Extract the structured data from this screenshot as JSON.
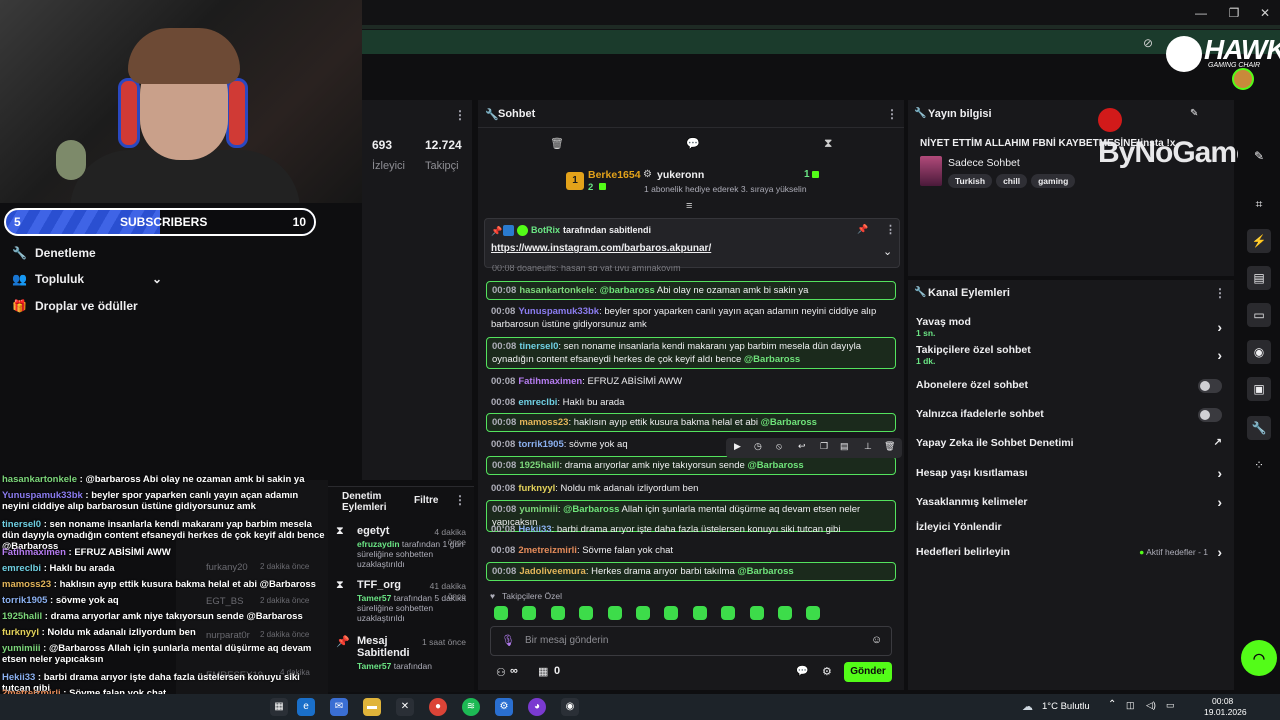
{
  "overlay": {
    "sub_left": "5",
    "sub_label": "SUBSCRIBERS",
    "sub_right": "10",
    "progress_fraction": 0.5,
    "hawk_brand": "HAWK",
    "hawk_sub": "GAMING CHAIR",
    "bynogame": "ByNoGame"
  },
  "left_nav": [
    {
      "label": "Denetleme",
      "icon": "wrench-icon"
    },
    {
      "label": "Topluluk",
      "icon": "community-icon"
    },
    {
      "label": "Droplar ve ödüller",
      "icon": "gift-icon"
    }
  ],
  "stats": {
    "viewers_value": "693",
    "viewers_label": "İzleyici",
    "followers_value": "12.724",
    "followers_label": "Takipçi"
  },
  "overlay_chat": [
    {
      "user": "hasankartonkele",
      "color": "#7cd67a",
      "text": "@barbaross Abi olay ne ozaman amk bi sakin ya"
    },
    {
      "user": "Yunuspamuk33bk",
      "color": "#8b7cf0",
      "text": "beyler spor yaparken canlı yayın açan adamın neyini ciddiye alıp barbarosun üstüne gidiyorsunuz amk"
    },
    {
      "user": "tinersel0",
      "color": "#6fd0e3",
      "text": "sen noname insanlarla kendi makaranı yap barbim mesela dün dayıyla oynadığın content efsaneydi herkes de çok keyif aldı bence @Barbaross"
    },
    {
      "user": "Fatihmaximen",
      "color": "#b57cf0",
      "text": "EFRUZ ABİSİMİ AWW"
    },
    {
      "user": "emreclbi",
      "color": "#6fd0e3",
      "text": "Haklı bu arada"
    },
    {
      "user": "mamoss23",
      "color": "#e3b55a",
      "text": "haklısın ayıp ettik kusura bakma helal et abi @Barbaross"
    },
    {
      "user": "torrik1905",
      "color": "#8bb0f0",
      "text": "sövme yok aq"
    },
    {
      "user": "1925halil",
      "color": "#7cd67a",
      "text": "drama arıyorlar amk niye takıyorsun sende @Barbaross"
    },
    {
      "user": "furknyyl",
      "color": "#e3d25a",
      "text": "Noldu mk adanalı izliyordum ben"
    },
    {
      "user": "yumimiii",
      "color": "#7cd67a",
      "text": "@Barbaross Allah için şunlarla mental düşürme aq devam etsen neler yapıcaksın"
    },
    {
      "user": "Hekii33",
      "color": "#8bb0f0",
      "text": "barbi drama arıyor işte daha fazla üstelersen konuyu siki tutcan gibi"
    },
    {
      "user": "2metreizmirli",
      "color": "#e38b5a",
      "text": "Sövme falan yok chat"
    },
    {
      "user": "Jadoliveemura",
      "color": "#e3b55a",
      "text": "Herkes drama arıyor barbi takılma @Barbaross"
    }
  ],
  "ghost_list": [
    {
      "name": "furkany20",
      "time": "2 dakika önce"
    },
    {
      "name": "EGT_BS",
      "time": "2 dakika önce"
    },
    {
      "name": "nurparat0r",
      "time": "2 dakika önce"
    },
    {
      "name": "EMRESEY19",
      "time": "4 dakika"
    }
  ],
  "mod_panel": {
    "title": "Denetim Eylemleri",
    "filter": "Filtre",
    "items": [
      {
        "title": "egetyt",
        "time": "4 dakika önce",
        "user": "efruzaydin",
        "desc": " tarafından 1 gün süreliğine sohbetten uzaklaştırıldı",
        "icon": "hourglass-icon"
      },
      {
        "title": "TFF_org",
        "time": "41 dakika önce",
        "user": "Tamer57",
        "desc": " tarafından 5 dakika süreliğine sohbetten uzaklaştırıldı",
        "icon": "hourglass-icon"
      },
      {
        "title": "Mesaj Sabitlendi",
        "time": "1 saat önce",
        "user": "Tamer57",
        "desc": " tarafından",
        "icon": "pin-icon"
      }
    ]
  },
  "chat": {
    "title": "Sohbet",
    "leader_name": "Berke1654",
    "leader_rank": "1",
    "leader_count": "2",
    "gifter_name": "yukeronn",
    "gifter_count": "1",
    "gifter_note": "1 abonelik hediye ederek 3. sıraya yükselin",
    "pinned_by": "BotRix",
    "pinned_suffix": "tarafından sabitlendi",
    "pinned_link": "https://www.instagram.com/barbaros.akpunar/",
    "cut_line": "00:08 doaneults: hasan sg yat uyu amınakoyım",
    "messages": [
      {
        "time": "00:08",
        "user": "hasankartonkele",
        "color": "#7cd67a",
        "text": " Abi olay ne ozaman amk bi sakin ya",
        "mention": "@barbaross",
        "mention_first": true,
        "hl": true
      },
      {
        "time": "00:08",
        "user": "Yunuspamuk33bk",
        "color": "#8b7cf0",
        "text": " beyler spor yaparken canlı yayın açan adamın neyini ciddiye alıp barbarosun üstüne gidiyorsunuz amk",
        "mention": "",
        "hl": false
      },
      {
        "time": "00:08",
        "user": "tinersel0",
        "color": "#6fd0e3",
        "text": " sen noname insanlarla kendi makaranı yap barbim mesela dün dayıyla oynadığın content efsaneydi herkes de çok keyif aldı bence ",
        "mention": "@Barbaross",
        "hl": true
      },
      {
        "time": "00:08",
        "user": "Fatihmaximen",
        "color": "#b57cf0",
        "text": " EFRUZ ABİSİMİ AWW",
        "mention": "",
        "hl": false
      },
      {
        "time": "00:08",
        "user": "emreclbi",
        "color": "#6fd0e3",
        "text": " Haklı bu arada",
        "mention": "",
        "hl": false
      },
      {
        "time": "00:08",
        "user": "mamoss23",
        "color": "#e3b55a",
        "text": " haklısın ayıp ettik kusura bakma helal et abi ",
        "mention": "@Barbaross",
        "hl": true
      },
      {
        "time": "00:08",
        "user": "torrik1905",
        "color": "#8bb0f0",
        "text": " sövme yok aq",
        "mention": "",
        "hl": false
      },
      {
        "time": "00:08",
        "user": "1925halil",
        "color": "#7cd67a",
        "text": " drama arıyorlar amk niye takıyorsun sende ",
        "mention": "@Barbaross",
        "hl": true
      },
      {
        "time": "00:08",
        "user": "furknyyl",
        "color": "#e3d25a",
        "text": " Noldu mk adanalı izliyordum ben",
        "mention": "",
        "hl": false
      },
      {
        "time": "00:08",
        "user": "yumimiii",
        "color": "#7cd67a",
        "text": " Allah için şunlarla mental düşürme aq devam etsen neler yapıcaksın",
        "mention": "@Barbaross",
        "mention_first": true,
        "hl": true
      },
      {
        "time": "00:08",
        "user": "Hekii33",
        "color": "#8bb0f0",
        "text": " barbi drama arıyor işte daha fazla üstelersen konuyu siki tutcan gibi",
        "mention": "",
        "hl": false
      },
      {
        "time": "00:08",
        "user": "2metreizmirli",
        "color": "#e38b5a",
        "text": " Sövme falan yok chat",
        "mention": "",
        "hl": false
      },
      {
        "time": "00:08",
        "user": "Jadoliveemura",
        "color": "#e3b55a",
        "text": " Herkes drama arıyor barbi takılma ",
        "mention": "@Barbaross",
        "hl": true
      }
    ],
    "followers_only": "Takipçilere Özel",
    "input_placeholder": "Bir mesaj gönderin",
    "infinity_count": "∞",
    "store_count": "0",
    "send_label": "Gönder"
  },
  "stream_info": {
    "header": "Yayın bilgisi",
    "title": "NİYET ETTİM ALLAHIM FBNİ KAYBETMESİNE!insta !x",
    "category": "Sadece Sohbet",
    "tags": [
      "Turkish",
      "chill",
      "gaming"
    ]
  },
  "channel_actions": {
    "header": "Kanal Eylemleri",
    "rows": [
      {
        "label": "Yavaş mod",
        "sub": "1 sn.",
        "kind": "chevron"
      },
      {
        "label": "Takipçilere özel sohbet",
        "sub": "1 dk.",
        "kind": "chevron"
      },
      {
        "label": "Abonelere özel sohbet",
        "sub": "",
        "kind": "toggle"
      },
      {
        "label": "Yalnızca ifadelerle sohbet",
        "sub": "",
        "kind": "toggle"
      },
      {
        "label": "Yapay Zeka ile Sohbet Denetimi",
        "sub": "",
        "kind": "external"
      },
      {
        "label": "Hesap yaşı kısıtlaması",
        "sub": "",
        "kind": "chevron"
      },
      {
        "label": "Yasaklanmış kelimeler",
        "sub": "",
        "kind": "chevron"
      },
      {
        "label": "İzleyici Yönlendir",
        "sub": "",
        "kind": "none"
      },
      {
        "label": "Hedefleri belirleyin",
        "sub": "",
        "kind": "goal",
        "extra": "Aktif hedefler - 1"
      }
    ]
  },
  "taskbar": {
    "weather": "1°C  Bulutlu",
    "time": "00:08",
    "date": "19.01.2026"
  },
  "colors": {
    "accent": "#53fc18",
    "highlight_border": "#54e35e",
    "panel": "#18181b"
  }
}
